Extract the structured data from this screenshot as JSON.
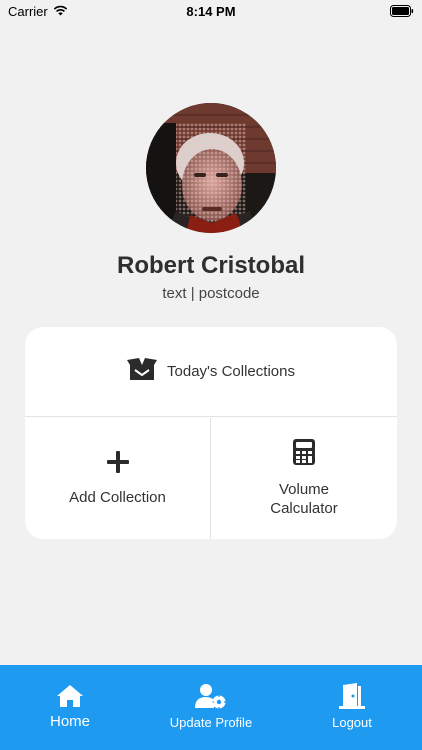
{
  "status_bar": {
    "carrier": "Carrier",
    "time": "8:14 PM"
  },
  "profile": {
    "name": "Robert Cristobal",
    "subtitle": "text | postcode"
  },
  "card": {
    "top": {
      "label": "Today's Collections",
      "icon": "box-icon"
    },
    "left": {
      "label": "Add Collection",
      "icon": "plus-icon"
    },
    "right": {
      "label": "Volume Calculator",
      "icon": "calculator-icon"
    }
  },
  "tab_bar": {
    "items": [
      {
        "label": "Home",
        "icon": "home-icon"
      },
      {
        "label": "Update Profile",
        "icon": "user-settings-icon"
      },
      {
        "label": "Logout",
        "icon": "door-exit-icon"
      }
    ]
  },
  "colors": {
    "accent": "#1e9bf0",
    "background": "#f1f1f1",
    "card": "#ffffff"
  }
}
